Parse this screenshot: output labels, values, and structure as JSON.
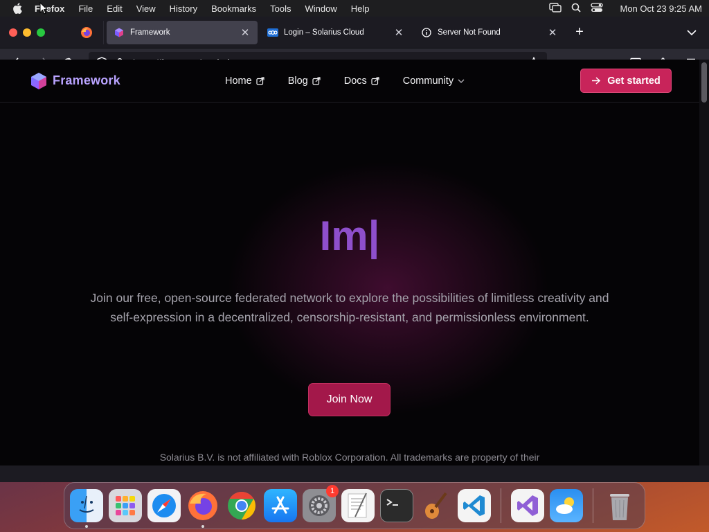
{
  "menubar": {
    "app_name": "Firefox",
    "items": [
      "File",
      "Edit",
      "View",
      "History",
      "Bookmarks",
      "Tools",
      "Window",
      "Help"
    ],
    "clock": "Mon Oct 23  9:25 AM"
  },
  "tabs": [
    {
      "title": "Framework",
      "active": true,
      "favicon": "framework-cube-icon"
    },
    {
      "title": "Login – Solarius Cloud",
      "active": false,
      "favicon": "cloud-logo-icon"
    },
    {
      "title": "Server Not Found",
      "active": false,
      "favicon": "info-icon"
    }
  ],
  "urlbar": {
    "url_prefix": "https://framework.",
    "url_domain": "solarius.me"
  },
  "site": {
    "brand": "Framework",
    "nav": [
      {
        "label": "Home",
        "icon": "external-link-icon"
      },
      {
        "label": "Blog",
        "icon": "external-link-icon"
      },
      {
        "label": "Docs",
        "icon": "external-link-icon"
      },
      {
        "label": "Community",
        "icon": "chevron-down-icon"
      }
    ],
    "cta_label": "Get started",
    "hero_title": "Im|",
    "hero_text": "Join our free, open-source federated network to explore the possibilities of limitless creativity and self-expression in a decentralized, censorship-resistant, and permissionless environment.",
    "join_label": "Join Now",
    "disclaimer": "Solarius B.V. is not affiliated with Roblox Corporation. All trademarks are property of their"
  },
  "dock": {
    "settings_badge": "1"
  },
  "colors": {
    "accent": "#c8245a",
    "brand": "#b9a3ff",
    "hero_title": "#8e4fcc"
  }
}
